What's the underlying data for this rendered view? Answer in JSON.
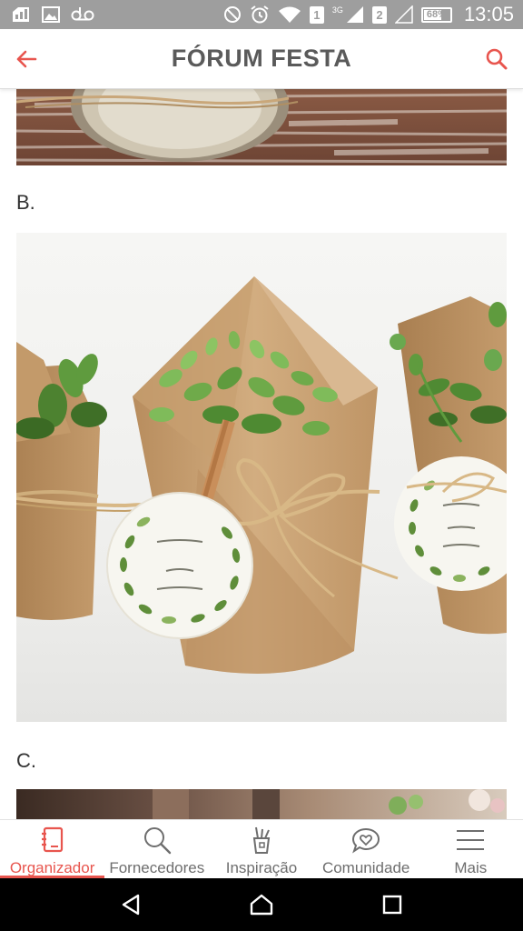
{
  "status_bar": {
    "time": "13:05",
    "battery": "68%",
    "battery_level": 0.68,
    "network": "3G",
    "sim_slot": "2",
    "icons": [
      "sim-card-icon",
      "image-icon",
      "voicemail-icon",
      "do-not-disturb-icon",
      "alarm-icon",
      "wifi-icon",
      "sim-slot-1-icon",
      "signal-icon",
      "sim-slot-2-icon",
      "signal-empty-icon",
      "battery-icon"
    ]
  },
  "app_bar": {
    "title": "FÓRUM FESTA",
    "back_icon": "arrow-left-icon",
    "search_icon": "search-icon"
  },
  "content": {
    "option_b": "B.",
    "option_c": "C."
  },
  "bottom_nav": {
    "items": [
      {
        "label": "Organizador",
        "icon": "notebook-icon",
        "active": true
      },
      {
        "label": "Fornecedores",
        "icon": "magnifier-icon",
        "active": false
      },
      {
        "label": "Inspiração",
        "icon": "pencil-cup-icon",
        "active": false
      },
      {
        "label": "Comunidade",
        "icon": "chat-heart-icon",
        "active": false
      },
      {
        "label": "Mais",
        "icon": "menu-icon",
        "active": false
      }
    ]
  },
  "system_nav": [
    "back-triangle-icon",
    "home-icon",
    "recents-icon"
  ],
  "colors": {
    "accent": "#e8554e",
    "status_bar": "#9e9e9e",
    "title": "#5a5a5a",
    "kraft": "#c9a57a",
    "plant": "#6aa84f"
  }
}
